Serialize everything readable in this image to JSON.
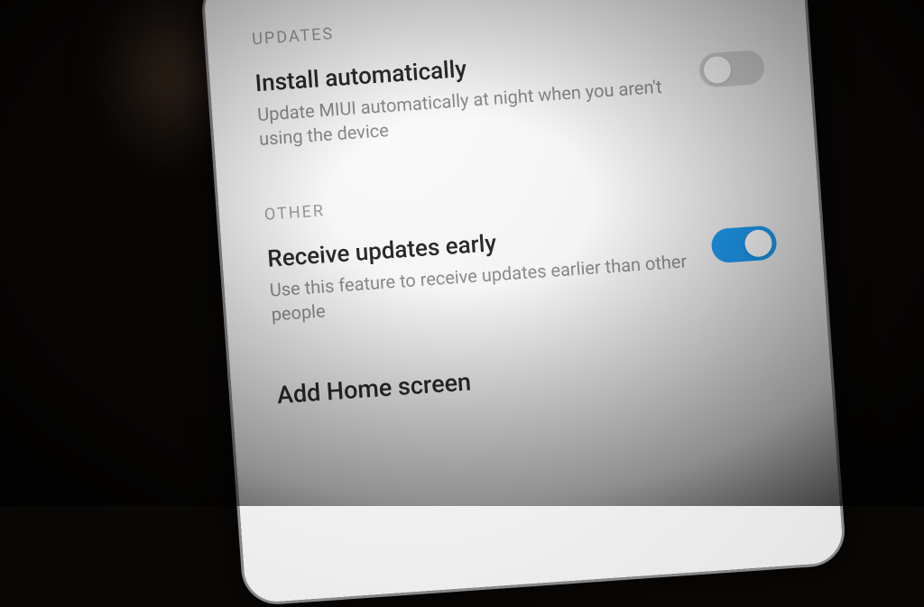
{
  "sections": {
    "updates": {
      "header": "UPDATES",
      "install_auto": {
        "title": "Install automatically",
        "description": "Update MIUI automatically at night when you aren't using the device",
        "enabled": false
      }
    },
    "other": {
      "header": "OTHER",
      "receive_early": {
        "title": "Receive updates early",
        "description": "Use this feature to receive updates earlier than other people",
        "enabled": true
      },
      "add_home": {
        "title": "Add Home screen"
      }
    }
  },
  "colors": {
    "toggle_on": "#1e9bf0",
    "toggle_off": "#d0d0d0",
    "text_primary": "#2a2a2a",
    "text_secondary": "#8a8a8a"
  }
}
